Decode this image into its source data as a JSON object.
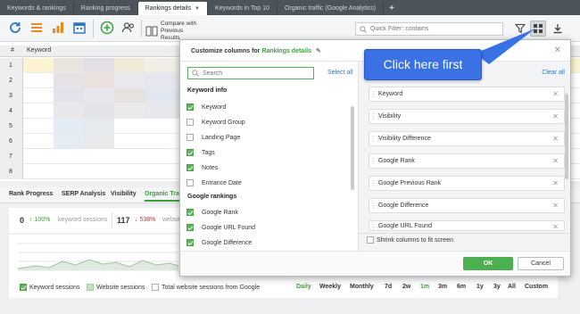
{
  "tabs": [
    {
      "label": "Keywords & rankings"
    },
    {
      "label": "Ranking progress"
    },
    {
      "label": "Rankings details"
    },
    {
      "label": "Keywords in Top 10"
    },
    {
      "label": "Organic traffic (Google Analytics)"
    }
  ],
  "toolbar": {
    "compare_label": "Compare with Previous Results",
    "filter_placeholder": "Quick Filter: contains"
  },
  "grid": {
    "col_num": "#",
    "col_keyword": "Keyword",
    "rows": [
      "1",
      "2",
      "3",
      "4",
      "5",
      "6",
      "7",
      "8"
    ]
  },
  "bottom": {
    "tabs": [
      "Rank Progress",
      "SERP Analysis",
      "Visibility",
      "Organic Traffi"
    ],
    "stat1_num": "0",
    "stat1_pct": "↑ 100%",
    "stat1_lbl": "keyword sessions",
    "stat2_num": "117",
    "stat2_pct": "↓ 538%",
    "stat2_lbl": "website s",
    "legend": [
      "Keyword sessions",
      "Website sessions",
      "Total website sessions from Google"
    ],
    "periods": [
      "Daily",
      "Weekly",
      "Monthly",
      "7d",
      "2w",
      "1m",
      "3m",
      "6m",
      "1y",
      "3y",
      "All",
      "Custom"
    ]
  },
  "dialog": {
    "title_prefix": "Customize columns for",
    "title_target": "Rankings details",
    "search_placeholder": "Search",
    "select_all": "Select all",
    "clear_all": "Clear all",
    "group1": "Keyword info",
    "options1": [
      {
        "label": "Keyword",
        "checked": true
      },
      {
        "label": "Keyword Group",
        "checked": false
      },
      {
        "label": "Landing Page",
        "checked": false
      },
      {
        "label": "Tags",
        "checked": true
      },
      {
        "label": "Notes",
        "checked": true
      },
      {
        "label": "Entrance Date",
        "checked": false
      }
    ],
    "group2": "Google rankings",
    "options2": [
      {
        "label": "Google Rank",
        "checked": true
      },
      {
        "label": "Google URL Found",
        "checked": true
      },
      {
        "label": "Google Difference",
        "checked": true
      }
    ],
    "selected": [
      "Keyword",
      "Visibility",
      "Visibility Difference",
      "Google Rank",
      "Google Previous Rank",
      "Google Difference",
      "Google URL Found"
    ],
    "shrink_label": "Shrink columns to fit screen",
    "ok": "OK",
    "cancel": "Cancel"
  },
  "callout": "Click here first",
  "colors": {
    "accent": "#4caf50",
    "callout": "#3a72e6",
    "link": "#2f78c4"
  }
}
